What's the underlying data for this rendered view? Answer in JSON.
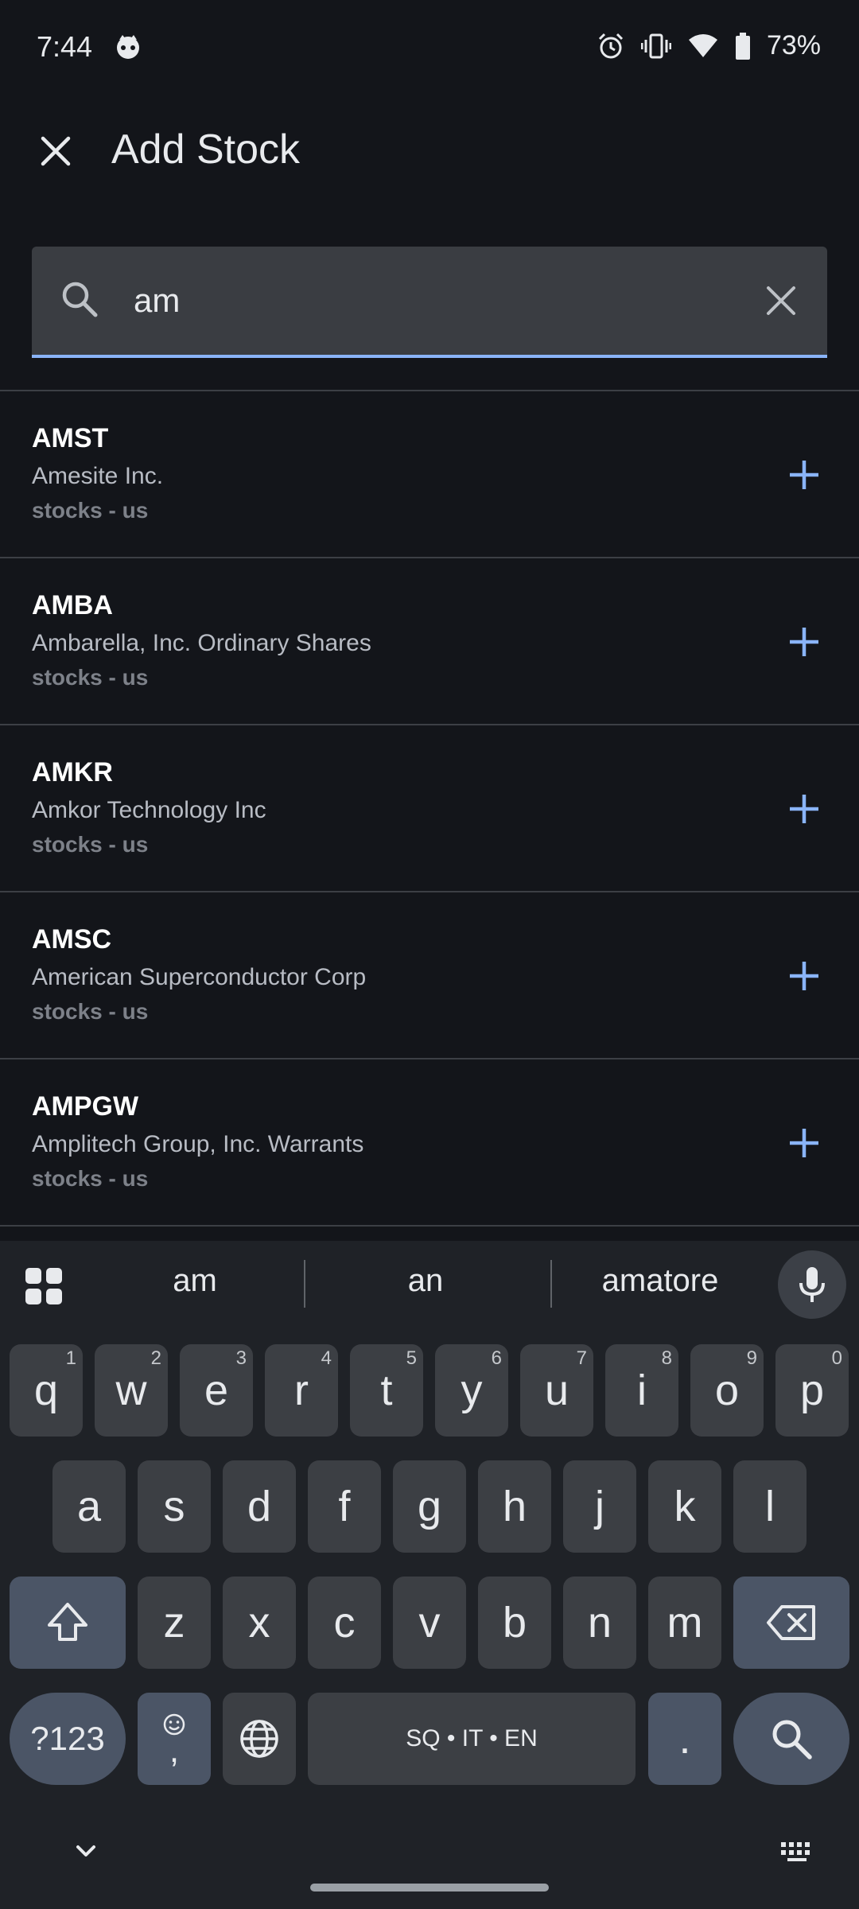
{
  "status_bar": {
    "time": "7:44",
    "battery": "73%"
  },
  "header": {
    "title": "Add Stock"
  },
  "search": {
    "value": "am"
  },
  "results": [
    {
      "ticker": "AMST",
      "name": "Amesite Inc.",
      "market": "stocks - us"
    },
    {
      "ticker": "AMBA",
      "name": "Ambarella, Inc. Ordinary Shares",
      "market": "stocks - us"
    },
    {
      "ticker": "AMKR",
      "name": "Amkor Technology Inc",
      "market": "stocks - us"
    },
    {
      "ticker": "AMSC",
      "name": "American Superconductor Corp",
      "market": "stocks - us"
    },
    {
      "ticker": "AMPGW",
      "name": "Amplitech Group, Inc. Warrants",
      "market": "stocks - us"
    }
  ],
  "keyboard": {
    "suggestions": [
      "am",
      "an",
      "amatore"
    ],
    "row1": [
      {
        "key": "q",
        "hint": "1"
      },
      {
        "key": "w",
        "hint": "2"
      },
      {
        "key": "e",
        "hint": "3"
      },
      {
        "key": "r",
        "hint": "4"
      },
      {
        "key": "t",
        "hint": "5"
      },
      {
        "key": "y",
        "hint": "6"
      },
      {
        "key": "u",
        "hint": "7"
      },
      {
        "key": "i",
        "hint": "8"
      },
      {
        "key": "o",
        "hint": "9"
      },
      {
        "key": "p",
        "hint": "0"
      }
    ],
    "row2": [
      "a",
      "s",
      "d",
      "f",
      "g",
      "h",
      "j",
      "k",
      "l"
    ],
    "row3": [
      "z",
      "x",
      "c",
      "v",
      "b",
      "n",
      "m"
    ],
    "symbols_label": "?123",
    "comma_label": ",",
    "space_label": "SQ • IT • EN",
    "period_label": "."
  },
  "colors": {
    "accent": "#8ab4f8",
    "background": "#13151a",
    "keyboard_bg": "#1f2227"
  }
}
